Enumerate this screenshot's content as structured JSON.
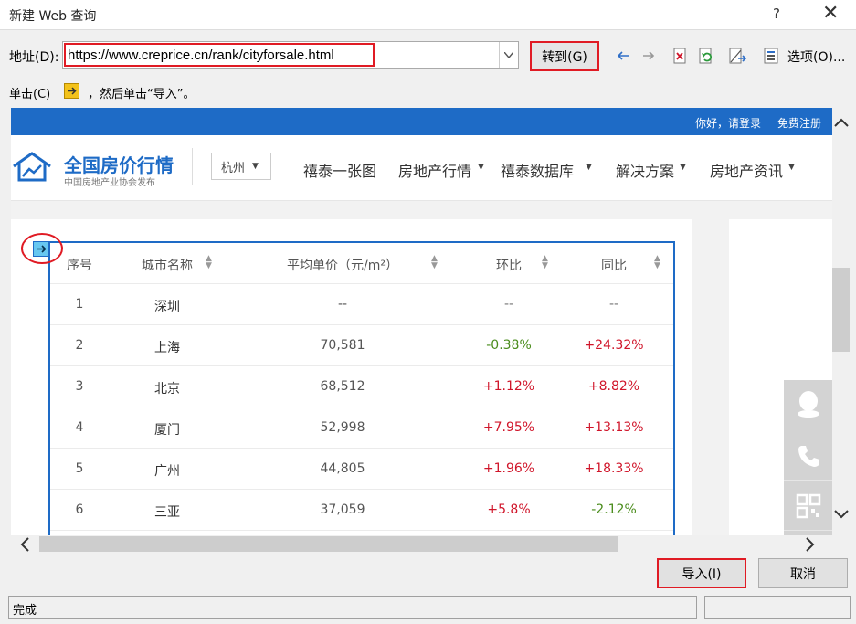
{
  "window": {
    "title": "新建 Web 查询",
    "help": "?",
    "close": "✕"
  },
  "address": {
    "label": "地址(D):",
    "value": "https://www.creprice.cn/rank/cityforsale.html",
    "go_label": "转到(G)"
  },
  "toolbar": {
    "options_label": "选项(O)..."
  },
  "hint": {
    "prefix": "单击(C)",
    "suffix": "，然后单击“导入”。"
  },
  "site": {
    "topbar": {
      "greeting": "你好，请登录",
      "register": "免费注册"
    },
    "logo": {
      "name": "全国房价行情",
      "subtitle": "中国房地产业协会发布"
    },
    "city": "杭州",
    "nav": [
      "禧泰一张图",
      "房地产行情",
      "禧泰数据库",
      "解决方案",
      "房地产资讯"
    ]
  },
  "table": {
    "headers": [
      "序号",
      "城市名称",
      "平均单价（元/m²）",
      "环比",
      "同比"
    ],
    "rows": [
      {
        "idx": "1",
        "city": "深圳",
        "price": "--",
        "mom": "--",
        "yoy": "--"
      },
      {
        "idx": "2",
        "city": "上海",
        "price": "70,581",
        "mom": "-0.38%",
        "yoy": "+24.32%"
      },
      {
        "idx": "3",
        "city": "北京",
        "price": "68,512",
        "mom": "+1.12%",
        "yoy": "+8.82%"
      },
      {
        "idx": "4",
        "city": "厦门",
        "price": "52,998",
        "mom": "+7.95%",
        "yoy": "+13.13%"
      },
      {
        "idx": "5",
        "city": "广州",
        "price": "44,805",
        "mom": "+1.96%",
        "yoy": "+18.33%"
      },
      {
        "idx": "6",
        "city": "三亚",
        "price": "37,059",
        "mom": "+5.8%",
        "yoy": "-2.12%"
      }
    ]
  },
  "buttons": {
    "import": "导入(I)",
    "cancel": "取消"
  },
  "status": {
    "text": "完成"
  },
  "colors": {
    "accent": "#1e6bc6",
    "highlight": "#e01b24",
    "positive": "#d0152a",
    "negative": "#4a8c1c"
  }
}
